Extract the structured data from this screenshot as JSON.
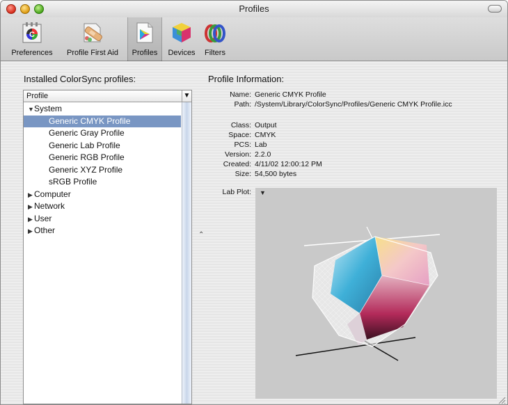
{
  "window": {
    "title": "Profiles"
  },
  "toolbar": {
    "items": [
      {
        "label": "Preferences",
        "icon": "preferences-icon"
      },
      {
        "label": "Profile First Aid",
        "icon": "first-aid-icon"
      },
      {
        "label": "Profiles",
        "icon": "profiles-icon",
        "selected": true
      },
      {
        "label": "Devices",
        "icon": "devices-icon"
      },
      {
        "label": "Filters",
        "icon": "filters-icon"
      }
    ]
  },
  "installed": {
    "heading": "Installed ColorSync profiles:",
    "column_header": "Profile",
    "tree": [
      {
        "label": "System",
        "expanded": true,
        "level": 0
      },
      {
        "label": "Generic CMYK Profile",
        "level": 1,
        "selected": true
      },
      {
        "label": "Generic Gray Profile",
        "level": 1
      },
      {
        "label": "Generic Lab Profile",
        "level": 1
      },
      {
        "label": "Generic RGB Profile",
        "level": 1
      },
      {
        "label": "Generic XYZ Profile",
        "level": 1
      },
      {
        "label": "sRGB Profile",
        "level": 1
      },
      {
        "label": "Computer",
        "expanded": false,
        "level": 0
      },
      {
        "label": "Network",
        "expanded": false,
        "level": 0
      },
      {
        "label": "User",
        "expanded": false,
        "level": 0
      },
      {
        "label": "Other",
        "expanded": false,
        "level": 0
      }
    ]
  },
  "info": {
    "heading": "Profile Information:",
    "name_label": "Name:",
    "name": "Generic CMYK Profile",
    "path_label": "Path:",
    "path": "/System/Library/ColorSync/Profiles/Generic CMYK Profile.icc",
    "class_label": "Class:",
    "class": "Output",
    "space_label": "Space:",
    "space": "CMYK",
    "pcs_label": "PCS:",
    "pcs": "Lab",
    "version_label": "Version:",
    "version": "2.2.0",
    "created_label": "Created:",
    "created": "4/11/02 12:00:12 PM",
    "size_label": "Size:",
    "size": "54,500 bytes",
    "plot_label": "Lab Plot:"
  },
  "colors": {
    "selection": "#7996c3"
  }
}
